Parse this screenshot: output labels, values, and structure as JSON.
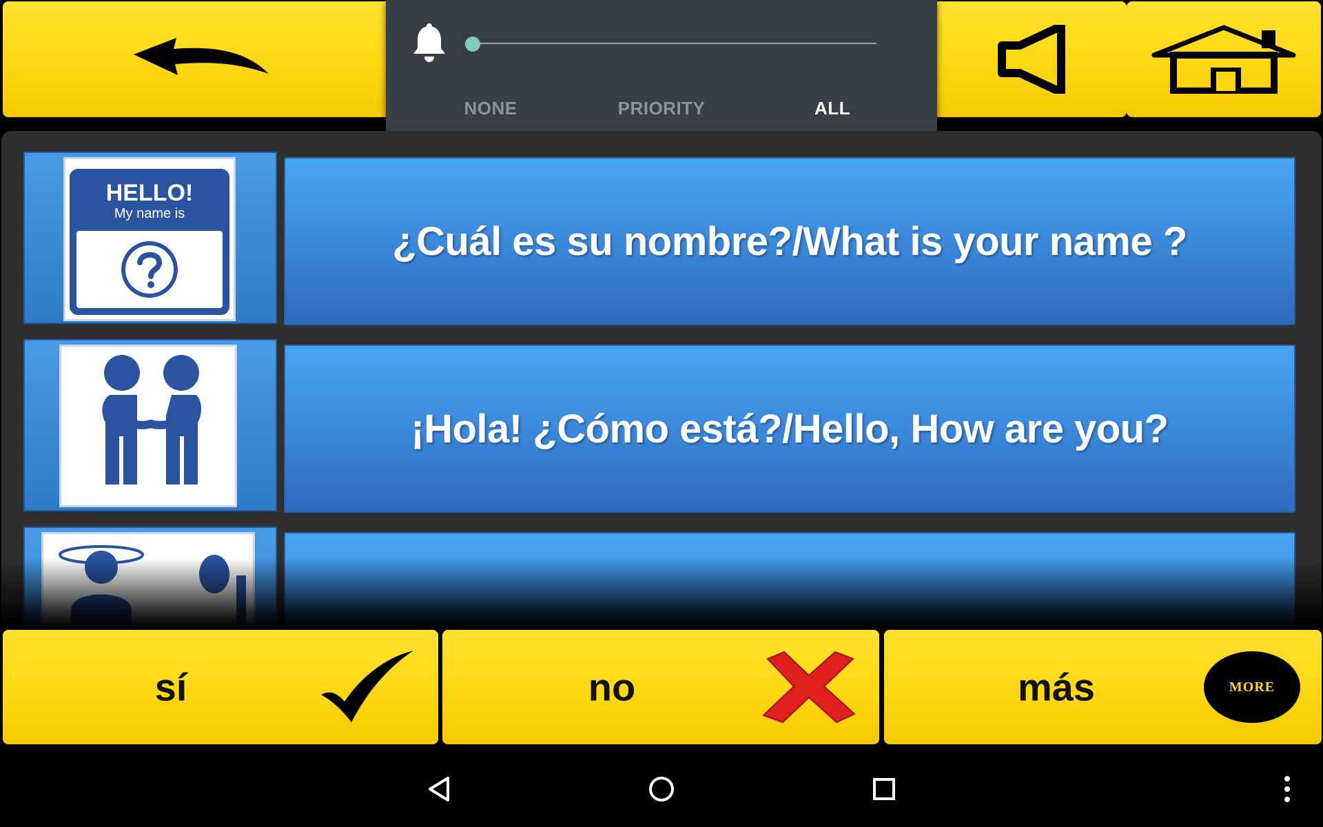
{
  "notification_panel": {
    "modes": [
      "NONE",
      "PRIORITY",
      "ALL"
    ],
    "selected_mode": "ALL",
    "volume_level": 0.0,
    "accent_color": "#80cbc4"
  },
  "phrases": [
    {
      "text": "¿Cuál es su nombre?/What is your name ?",
      "pictogram": "hello-name-tag-icon",
      "tag_line1": "HELLO!",
      "tag_line2": "My name is"
    },
    {
      "text": "¡Hola! ¿Cómo está?/Hello, How are you?",
      "pictogram": "handshake-icon"
    },
    {
      "text": "",
      "pictogram": "dizzy-person-icon"
    }
  ],
  "bottom": {
    "yes_label": "sí",
    "no_label": "no",
    "more_label": "más",
    "more_badge": "MORE"
  },
  "colors": {
    "yellow": "#ffd812",
    "phrase_blue": "#3e8fe0",
    "no_red": "#e0201f"
  }
}
